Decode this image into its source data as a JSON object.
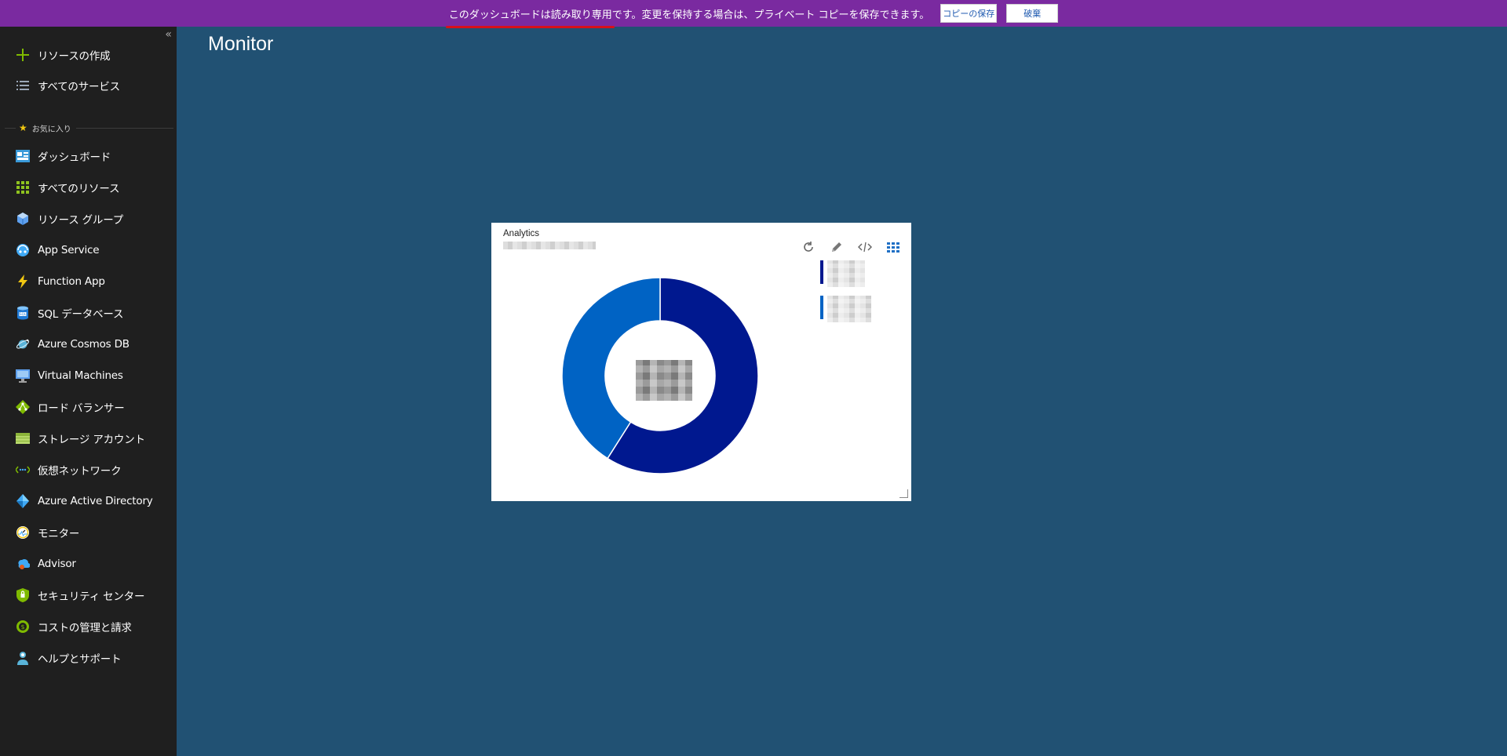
{
  "banner": {
    "message": "このダッシュボードは読み取り専用です。変更を保持する場合は、プライベート コピーを保存できます。",
    "save_copy_label": "コピーの保存",
    "discard_label": "破棄",
    "background": "#7a2aa0"
  },
  "sidebar": {
    "collapse_icon": "«",
    "create_resource": "リソースの作成",
    "all_services": "すべてのサービス",
    "favorites_label": "お気に入り",
    "items": [
      {
        "label": "ダッシュボード",
        "icon": "dashboard-icon"
      },
      {
        "label": "すべてのリソース",
        "icon": "grid-icon"
      },
      {
        "label": "リソース グループ",
        "icon": "resource-group-icon"
      },
      {
        "label": "App Service",
        "icon": "app-service-icon"
      },
      {
        "label": "Function App",
        "icon": "function-icon"
      },
      {
        "label": "SQL データベース",
        "icon": "sql-icon"
      },
      {
        "label": "Azure Cosmos DB",
        "icon": "cosmos-icon"
      },
      {
        "label": "Virtual Machines",
        "icon": "vm-icon"
      },
      {
        "label": "ロード バランサー",
        "icon": "load-balancer-icon"
      },
      {
        "label": "ストレージ アカウント",
        "icon": "storage-icon"
      },
      {
        "label": "仮想ネットワーク",
        "icon": "vnet-icon"
      },
      {
        "label": "Azure Active Directory",
        "icon": "aad-icon"
      },
      {
        "label": "モニター",
        "icon": "monitor-icon"
      },
      {
        "label": "Advisor",
        "icon": "advisor-icon"
      },
      {
        "label": "セキュリティ センター",
        "icon": "security-icon"
      },
      {
        "label": "コストの管理と請求",
        "icon": "cost-icon"
      },
      {
        "label": "ヘルプとサポート",
        "icon": "help-icon"
      }
    ]
  },
  "main": {
    "title": "Monitor",
    "tile": {
      "title": "Analytics",
      "tools": [
        "refresh-icon",
        "edit-icon",
        "code-icon",
        "grid-icon"
      ]
    }
  },
  "chart_data": {
    "type": "pie",
    "title": "",
    "series": [
      {
        "value": 0.59,
        "color": "#00188f"
      },
      {
        "value": 0.41,
        "color": "#0063c4"
      }
    ]
  }
}
